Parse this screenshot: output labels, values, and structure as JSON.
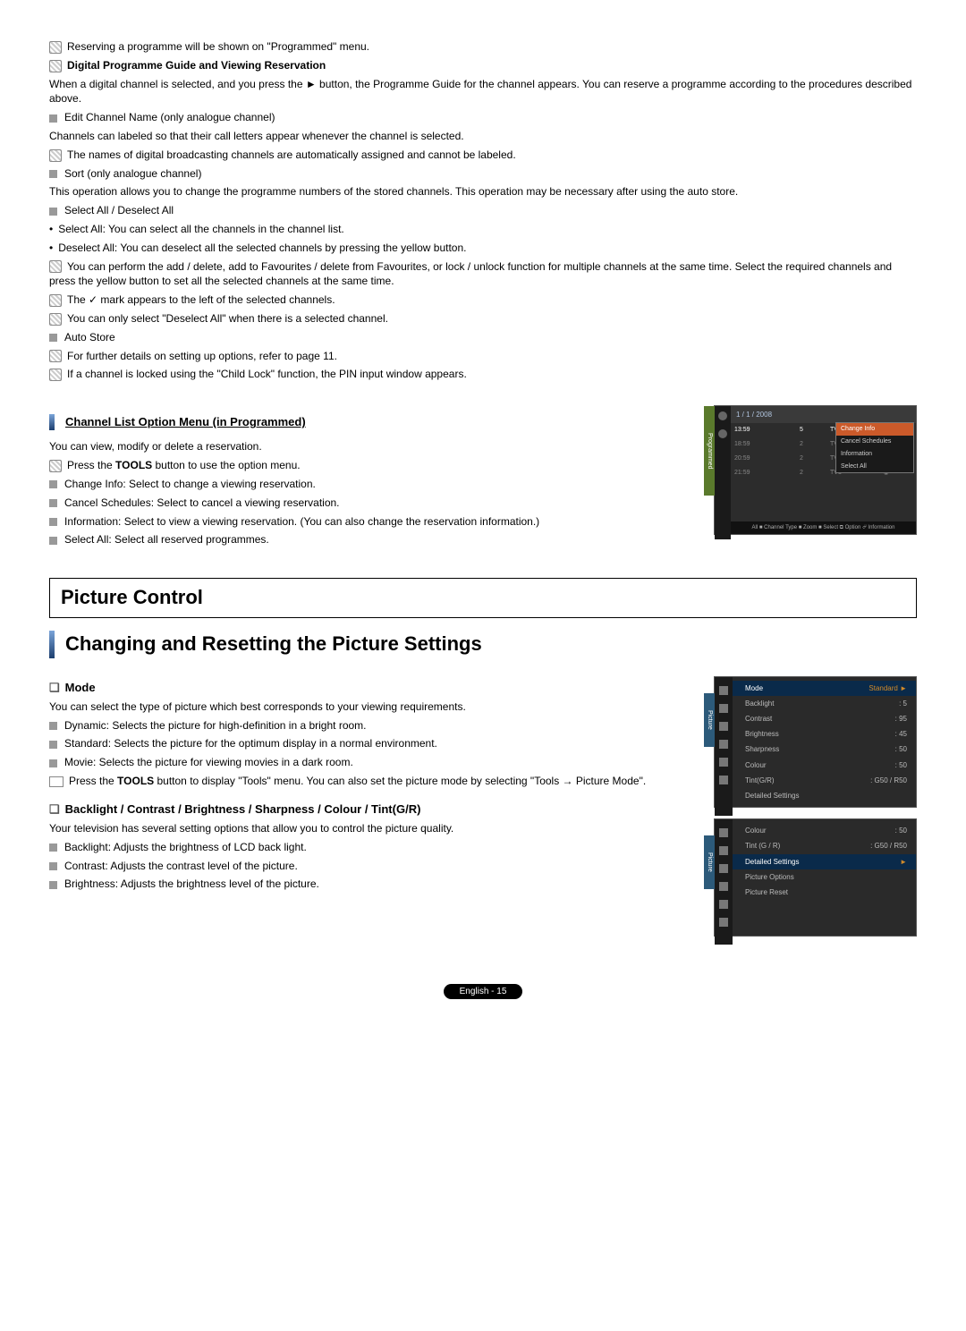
{
  "notes": {
    "n1": "Reserving a programme will be shown on \"Programmed\" menu.",
    "n2_title": "Digital Programme Guide and Viewing Reservation",
    "n2_body": "When a digital channel is selected, and you press the ► button, the Programme Guide for the channel appears. You can reserve a programme according to the procedures described above."
  },
  "edit_channel": {
    "title": "Edit Channel Name (only analogue channel)",
    "desc": "Channels can labeled so that their call letters appear whenever the channel is selected.",
    "note": "The names of digital broadcasting channels are automatically assigned and cannot be labeled."
  },
  "sort": {
    "title": "Sort (only analogue channel)",
    "desc": "This operation allows you to change the programme numbers of the stored channels. This operation may be necessary after using the auto store."
  },
  "select_all": {
    "title": "Select All / Deselect All",
    "b1": "Select All: You can select all the channels in the channel list.",
    "b2": "Deselect All: You can deselect all the selected channels by pressing the yellow button.",
    "n1": "You can perform the add / delete, add to Favourites / delete from Favourites, or lock / unlock function for multiple channels at the same time. Select the required channels and press the yellow button to set all the selected channels at the same time.",
    "n2": "The ✓ mark appears to the left of the selected channels.",
    "n3": "You can only select \"Deselect All\" when there is a selected channel."
  },
  "auto_store": {
    "title": "Auto Store",
    "n1": "For further details on setting up options, refer to page 11.",
    "n2": "If a channel is locked using the \"Child Lock\" function, the PIN input window appears."
  },
  "clom": {
    "heading": "Channel List Option Menu (in Programmed)",
    "intro": "You can view, modify or delete a reservation.",
    "note": "Press the TOOLS button to use the option menu.",
    "i1": "Change Info: Select to change a viewing reservation.",
    "i2": "Cancel Schedules: Select to cancel a viewing reservation.",
    "i3": "Information: Select to view a viewing reservation. (You can also change the reservation information.)",
    "i4": "Select All: Select all reserved programmes."
  },
  "osd1": {
    "tab": "Programmed",
    "date": "1 / 1 / 2008",
    "rows": [
      {
        "t": "13:59",
        "n": "5",
        "c": "TV1",
        "active": true
      },
      {
        "t": "18:59",
        "n": "2",
        "c": "TV3",
        "active": false
      },
      {
        "t": "20:59",
        "n": "2",
        "c": "TV3",
        "active": false
      },
      {
        "t": "21:59",
        "n": "2",
        "c": "TV3",
        "active": false
      }
    ],
    "popup": [
      "Change Info",
      "Cancel Schedules",
      "Information",
      "Select All"
    ],
    "bottom": "All   ■ Channel Type  ■ Zoom  ■ Select  ⧉ Option  ⏎ Information"
  },
  "picture_control": "Picture Control",
  "changing_title": "Changing and Resetting the Picture Settings",
  "mode": {
    "title": "Mode",
    "intro": "You can select the type of picture which best corresponds to your viewing requirements.",
    "i1": "Dynamic: Selects the picture for high-definition in a bright room.",
    "i2": "Standard: Selects the picture for the optimum display in a normal environment.",
    "i3": "Movie: Selects the picture for viewing movies in a dark room.",
    "note": "Press the TOOLS button to display \"Tools\" menu. You can also set the picture mode by selecting \"Tools → Picture Mode\"."
  },
  "bct": {
    "title": "Backlight / Contrast / Brightness / Sharpness / Colour / Tint(G/R)",
    "intro": "Your television has several setting options that allow you to control the picture quality.",
    "i1": "Backlight: Adjusts the brightness of LCD back light.",
    "i2": "Contrast: Adjusts the contrast level of the picture.",
    "i3": "Brightness: Adjusts the brightness level of the picture."
  },
  "osd2a": {
    "tab": "Picture",
    "rows": [
      {
        "k": "Mode",
        "v": "Standard",
        "head": true,
        "arrow": true
      },
      {
        "k": "Backlight",
        "v": ": 5"
      },
      {
        "k": "Contrast",
        "v": ": 95"
      },
      {
        "k": "Brightness",
        "v": ": 45"
      },
      {
        "k": "Sharpness",
        "v": ": 50"
      },
      {
        "k": "Colour",
        "v": ": 50"
      },
      {
        "k": "Tint(G/R)",
        "v": ": G50 / R50"
      },
      {
        "k": "Detailed Settings",
        "v": ""
      }
    ]
  },
  "osd2b": {
    "tab": "Picture",
    "rows": [
      {
        "k": "Colour",
        "v": ": 50"
      },
      {
        "k": "Tint (G / R)",
        "v": ": G50 / R50"
      },
      {
        "k": "Detailed Settings",
        "v": "",
        "head": true,
        "arrow": true
      },
      {
        "k": "Picture Options",
        "v": ""
      },
      {
        "k": "Picture Reset",
        "v": ""
      }
    ]
  },
  "footer": "English - 15"
}
